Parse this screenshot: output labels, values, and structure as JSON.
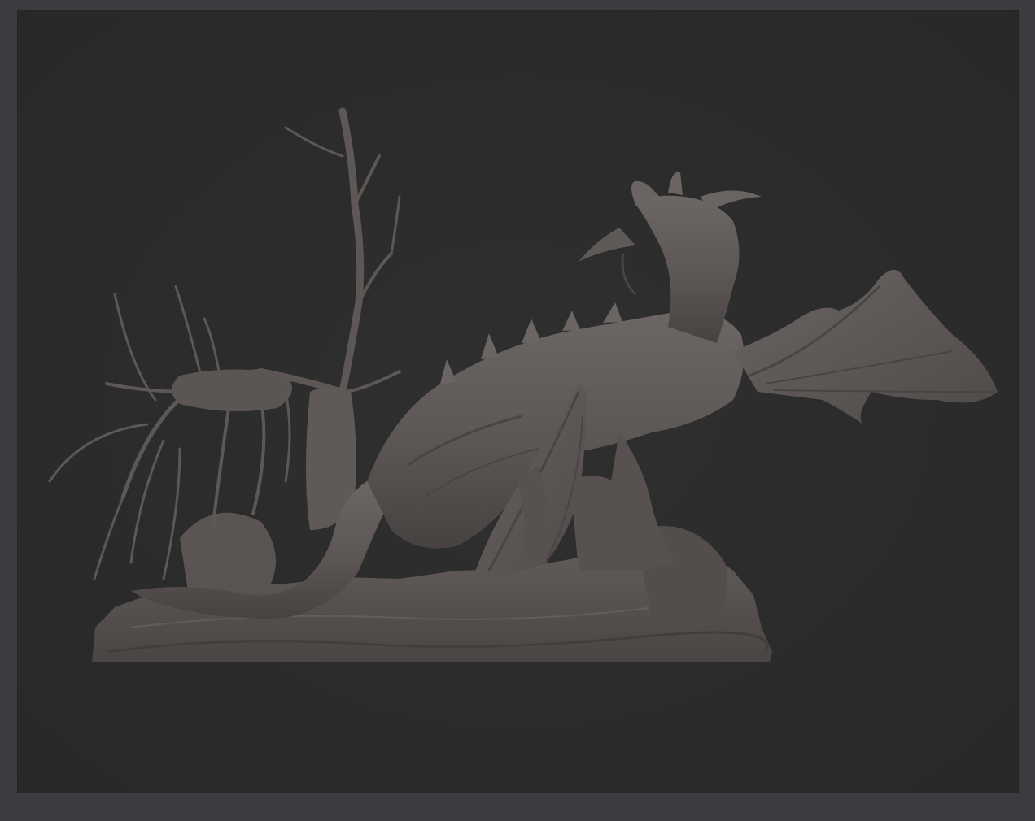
{
  "viewport": {
    "background_color": "#2b2b2b",
    "frame_color": "#3a3c3f",
    "model": {
      "subject": "dragon-on-rocks-with-dead-tree-sculpt",
      "material_color": "#5f5a58",
      "shadow_color": "#3e3a39",
      "highlight_color": "#7a7472"
    }
  }
}
